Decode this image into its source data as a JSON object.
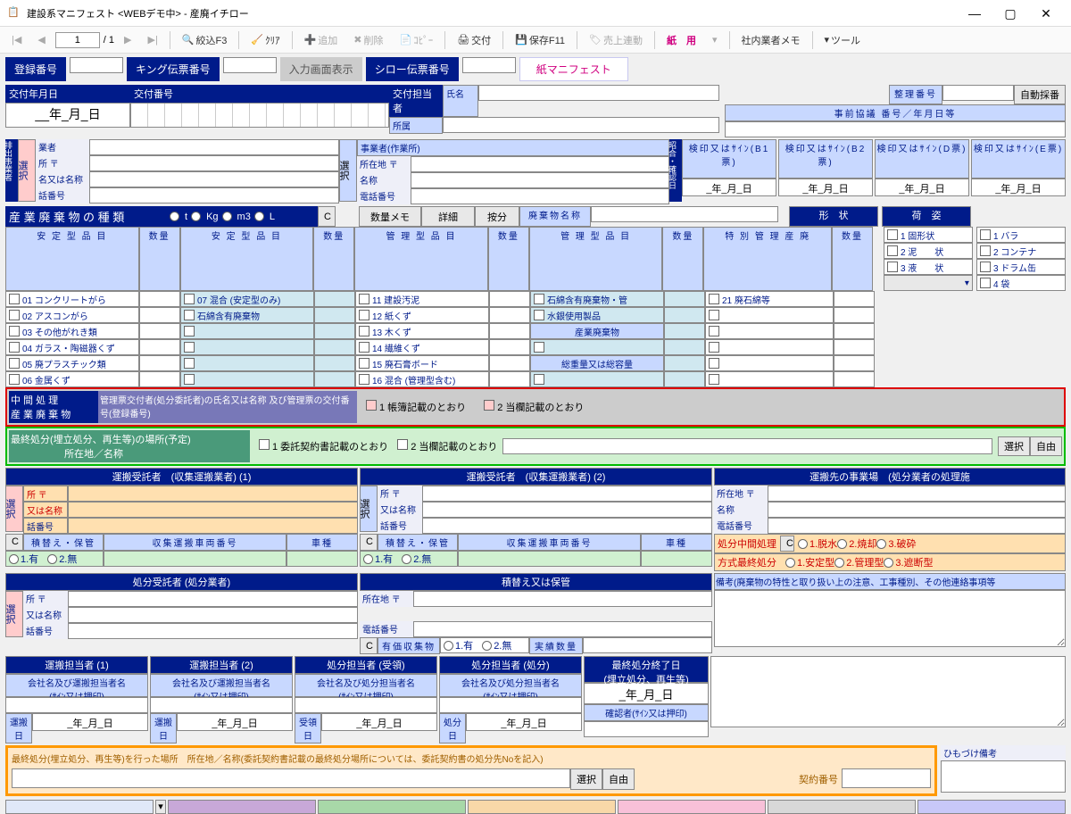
{
  "window": {
    "title": "建設系マニフェスト <WEBデモ中> - 産廃イチロー"
  },
  "toolbar": {
    "page": "1",
    "total": "/ 1",
    "narrow": "絞込F3",
    "clear": "ｸﾘｱ",
    "add": "追加",
    "del": "削除",
    "copy": "ｺﾋﾟｰ",
    "issue": "交付",
    "save": "保存F11",
    "sales": "売上連動",
    "paper": "紙　用",
    "memo": "社内業者メモ",
    "tools": "ツール"
  },
  "topbtns": {
    "reg": "登録番号",
    "king": "キング伝票番号",
    "input": "入力画面表示",
    "shiro": "シロー伝票番号",
    "paper": "紙マニフェスト"
  },
  "header": {
    "koufudate": "交付年月日",
    "date_placeholder": "__年_月_日",
    "koufunum": "交付番号",
    "koufuperson": "交付担当者",
    "shozoku": "所属",
    "shimei": "氏名",
    "seiriNo": "整理番号",
    "autoNum": "自動採番",
    "jizen": "事前協議 番号／年月日等"
  },
  "emitter": {
    "title": "排出事業者",
    "sel": "選択",
    "gyosha": "業者",
    "addr": "所 〒",
    "name": "名又は名称",
    "tel": "話番号",
    "site": "事業者(作業所)",
    "siteAddr": "所在地 〒",
    "siteName": "名称",
    "siteTel": "電話番号"
  },
  "stamps": {
    "col": "昭合・確認日",
    "b1": "検印又はｻｲﾝ(B1票)",
    "b2": "検印又はｻｲﾝ(B2票)",
    "d": "検印又はｻｲﾝ(D票)",
    "e": "検印又はｻｲﾝ(E票)",
    "date": "_年_月_日"
  },
  "waste": {
    "title": "産 業 廃 棄 物 の 種 類",
    "units": [
      "t",
      "Kg",
      "m3",
      "L"
    ],
    "c": "C",
    "qtyMemo": "数量メモ",
    "detail": "詳細",
    "anbun": "按分",
    "wasteName": "廃棄物名称",
    "keijo": "形　状",
    "nisugata": "荷　姿",
    "col_antei": "安 定 型 品 目",
    "col_qty": "数量",
    "col_kanri": "管 理 型 品 目",
    "col_tokubetsu": "特 別 管 理 産 廃",
    "antei1": [
      "01 コンクリートがら",
      "02 アスコンがら",
      "03 その他がれき類",
      "04 ガラス・陶磁器くず",
      "05 廃プラスチック類",
      "06 金属くず"
    ],
    "antei2": [
      "07 混合 (安定型のみ)",
      "石綿含有廃棄物",
      "",
      "",
      "",
      ""
    ],
    "kanri1": [
      "11 建設汚泥",
      "12 紙くず",
      "13 木くず",
      "14 繊維くず",
      "15 廃石膏ボード",
      "16 混合 (管理型含む)"
    ],
    "kanri2": [
      "石綿含有廃棄物・管",
      "水銀使用製品",
      "産業廃棄物",
      "",
      "総重量又は総容量",
      ""
    ],
    "tokubetsu": [
      "21 廃石綿等"
    ],
    "keijo_items": [
      "1 固形状",
      "2 泥　　状",
      "3 液　　状"
    ],
    "nisugata_items": [
      "1 バラ",
      "2 コンテナ",
      "3 ドラム缶",
      "4 袋"
    ]
  },
  "mid": {
    "title1": "中 間 処 理",
    "title2": "産 業 廃 棄 物",
    "desc": "管理票交付者(処分委託者)の氏名又は名称 及び管理票の交付番号(登録番号)",
    "opt1": "1 帳簿記載のとおり",
    "opt2": "2 当欄記載のとおり"
  },
  "final": {
    "title": "最終処分(埋立処分、再生等)の場所(予定)",
    "sub": "所在地／名称",
    "opt1": "1 委託契約書記載のとおり",
    "opt2": "2 当欄記載のとおり",
    "sel": "選択",
    "free": "自由"
  },
  "trans1": {
    "hdr1": "運搬受託者　(収集運搬業者) (1)",
    "hdr2": "運搬受託者　(収集運搬業者) (2)",
    "hdr3": "運搬先の事業場　(処分業者の処理施",
    "sel": "選択",
    "addr": "所 〒",
    "name": "又は名称",
    "tel": "話番号",
    "shozai": "所在地 〒",
    "meisho": "名称",
    "denwa": "電話番号",
    "c": "C",
    "tsumi": "積替え・保管",
    "sharyo": "収集運搬車両番号",
    "shashu": "車種",
    "ari": "1.有",
    "nashi": "2.無",
    "shobun_chukan": "処分中間処理",
    "dassui": "1.脱水",
    "shokyaku": "2.焼却",
    "hasai": "3.破砕",
    "houshiki": "方式最終処分",
    "antei": "1.安定型",
    "kanri": "2.管理型",
    "shadan": "3.遮断型"
  },
  "shobun": {
    "hdr": "処分受託者 (処分業者)",
    "hdr2": "積替え又は保管",
    "addr": "所 〒",
    "name": "又は名称",
    "tel": "話番号",
    "shozai": "所在地 〒",
    "denwa": "電話番号",
    "c": "C",
    "yuka": "有価収集物",
    "ari": "1.有",
    "nashi": "2.無",
    "jisseki": "実績数量",
    "biko": "備考(廃棄物の特性と取り扱い上の注意、工事種別、その他連絡事項等"
  },
  "tanto": {
    "u1": "運搬担当者 (1)",
    "u2": "運搬担当者 (2)",
    "s1": "処分担当者 (受領)",
    "s2": "処分担当者 (処分)",
    "desc_u": "会社名及び運搬担当者名\n(ｻｲﾝ又は押印)",
    "desc_s": "会社名及び処分担当者名\n(ｻｲﾝ又は押印)",
    "final": "最終処分終了日\n(埋立処分、再生等)",
    "date": "_年_月_日",
    "unhi": "運搬日",
    "jyuhi": "受領日",
    "shohi": "処分日",
    "kakunin": "確認者(ｻｲﾝ又は押印)"
  },
  "bottom": {
    "title": "最終処分(埋立処分、再生等)を行った場所　所在地／名称(委託契約書記載の最終処分場所については、委託契約書の処分先Noを記入)",
    "sel": "選択",
    "free": "自由",
    "keiyaku": "契約番号",
    "himo": "ひもづけ備考"
  }
}
